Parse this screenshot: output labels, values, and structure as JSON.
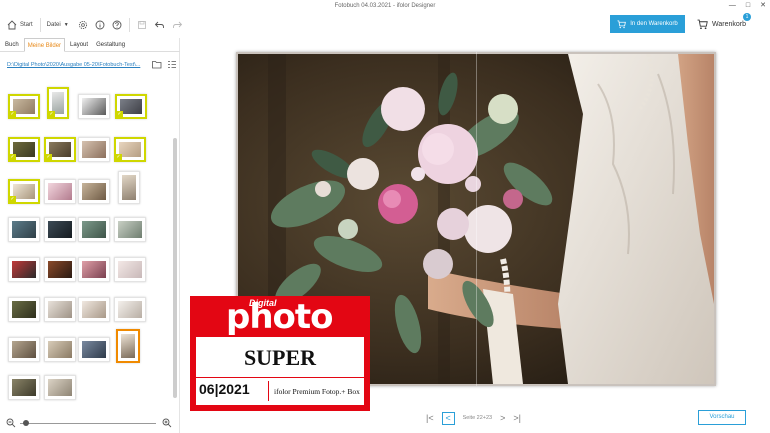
{
  "window": {
    "title": "Fotobuch 04.03.2021 - ifolor Designer"
  },
  "toolbar": {
    "start_label": "Start",
    "file_label": "Datei",
    "add_to_cart_label": "In den Warenkorb",
    "cart_label": "Warenkorb",
    "cart_count": "1",
    "accent_color": "#2a9fd8"
  },
  "leftpanel": {
    "tabs": [
      "Buch",
      "Meine Bilder",
      "Layout",
      "Gestaltung"
    ],
    "active_tab": "Meine Bilder",
    "path": "D:\\Digital Photo\\2020\\Ausgabe 05-20\\Fotobuch-Test\\..."
  },
  "canvas": {
    "page_info": "Seite 22+23",
    "preview_label": "Vorschau"
  },
  "award": {
    "brand_top": "Digital",
    "brand_main": "photo",
    "rating": "SUPER",
    "issue": "06|2021",
    "product": "ifolor Premium Fotop.+ Box",
    "color": "#e30613"
  }
}
